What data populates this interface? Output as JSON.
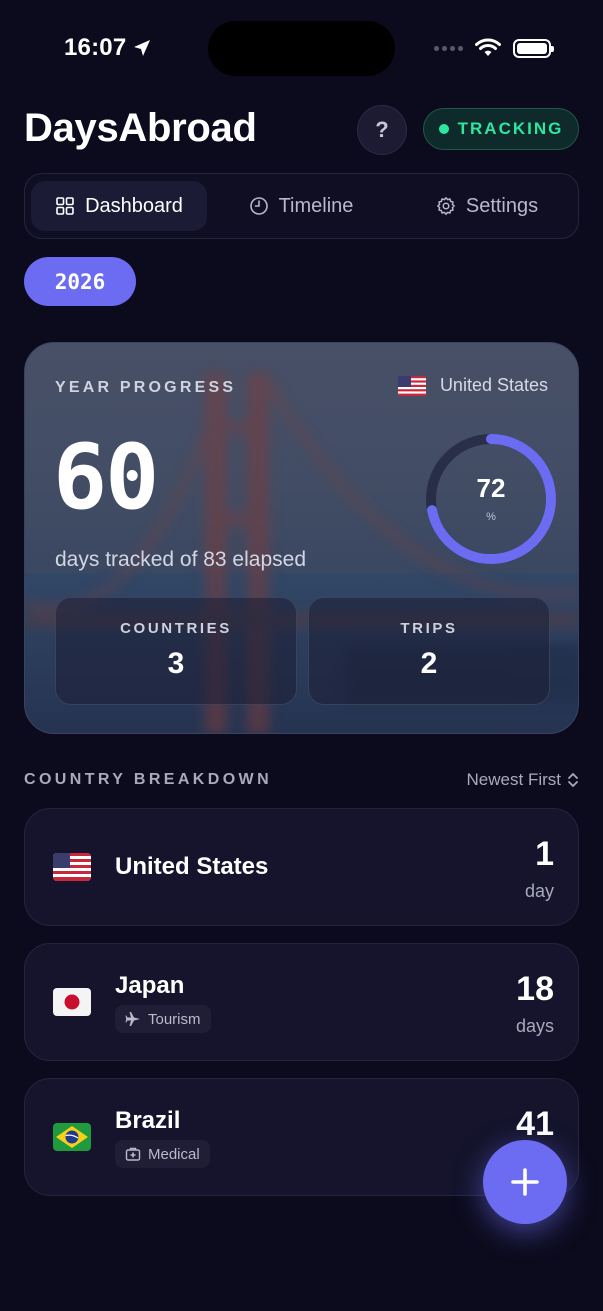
{
  "status_bar": {
    "time": "16:07",
    "location_icon": "location-arrow-icon"
  },
  "header": {
    "title": "DaysAbroad",
    "help_label": "?",
    "tracking_label": "TRACKING",
    "tracking_color": "#2ee6a0"
  },
  "tabs": [
    {
      "label": "Dashboard",
      "icon": "grid-icon",
      "active": true
    },
    {
      "label": "Timeline",
      "icon": "clock-icon",
      "active": false
    },
    {
      "label": "Settings",
      "icon": "gear-icon",
      "active": false
    }
  ],
  "year": "2026",
  "progress": {
    "label": "YEAR PROGRESS",
    "country": "United States",
    "days_tracked": "60",
    "subtitle": "days tracked of 83 elapsed",
    "percent": "72",
    "percent_unit": "%",
    "percent_value": 0.72,
    "countries_label": "COUNTRIES",
    "countries_value": "3",
    "trips_label": "TRIPS",
    "trips_value": "2",
    "accent": "#6c6cf2"
  },
  "breakdown": {
    "title": "COUNTRY BREAKDOWN",
    "sort_label": "Newest First",
    "items": [
      {
        "name": "United States",
        "flag": "us-flag-icon",
        "count": "1",
        "unit": "day"
      },
      {
        "name": "Japan",
        "flag": "japan-flag-icon",
        "tag": "Tourism",
        "tag_icon": "airplane-icon",
        "count": "18",
        "unit": "days"
      },
      {
        "name": "Brazil",
        "flag": "brazil-flag-icon",
        "tag": "Medical",
        "tag_icon": "medical-kit-icon",
        "count": "41"
      }
    ]
  },
  "fab": {
    "label": "+"
  }
}
